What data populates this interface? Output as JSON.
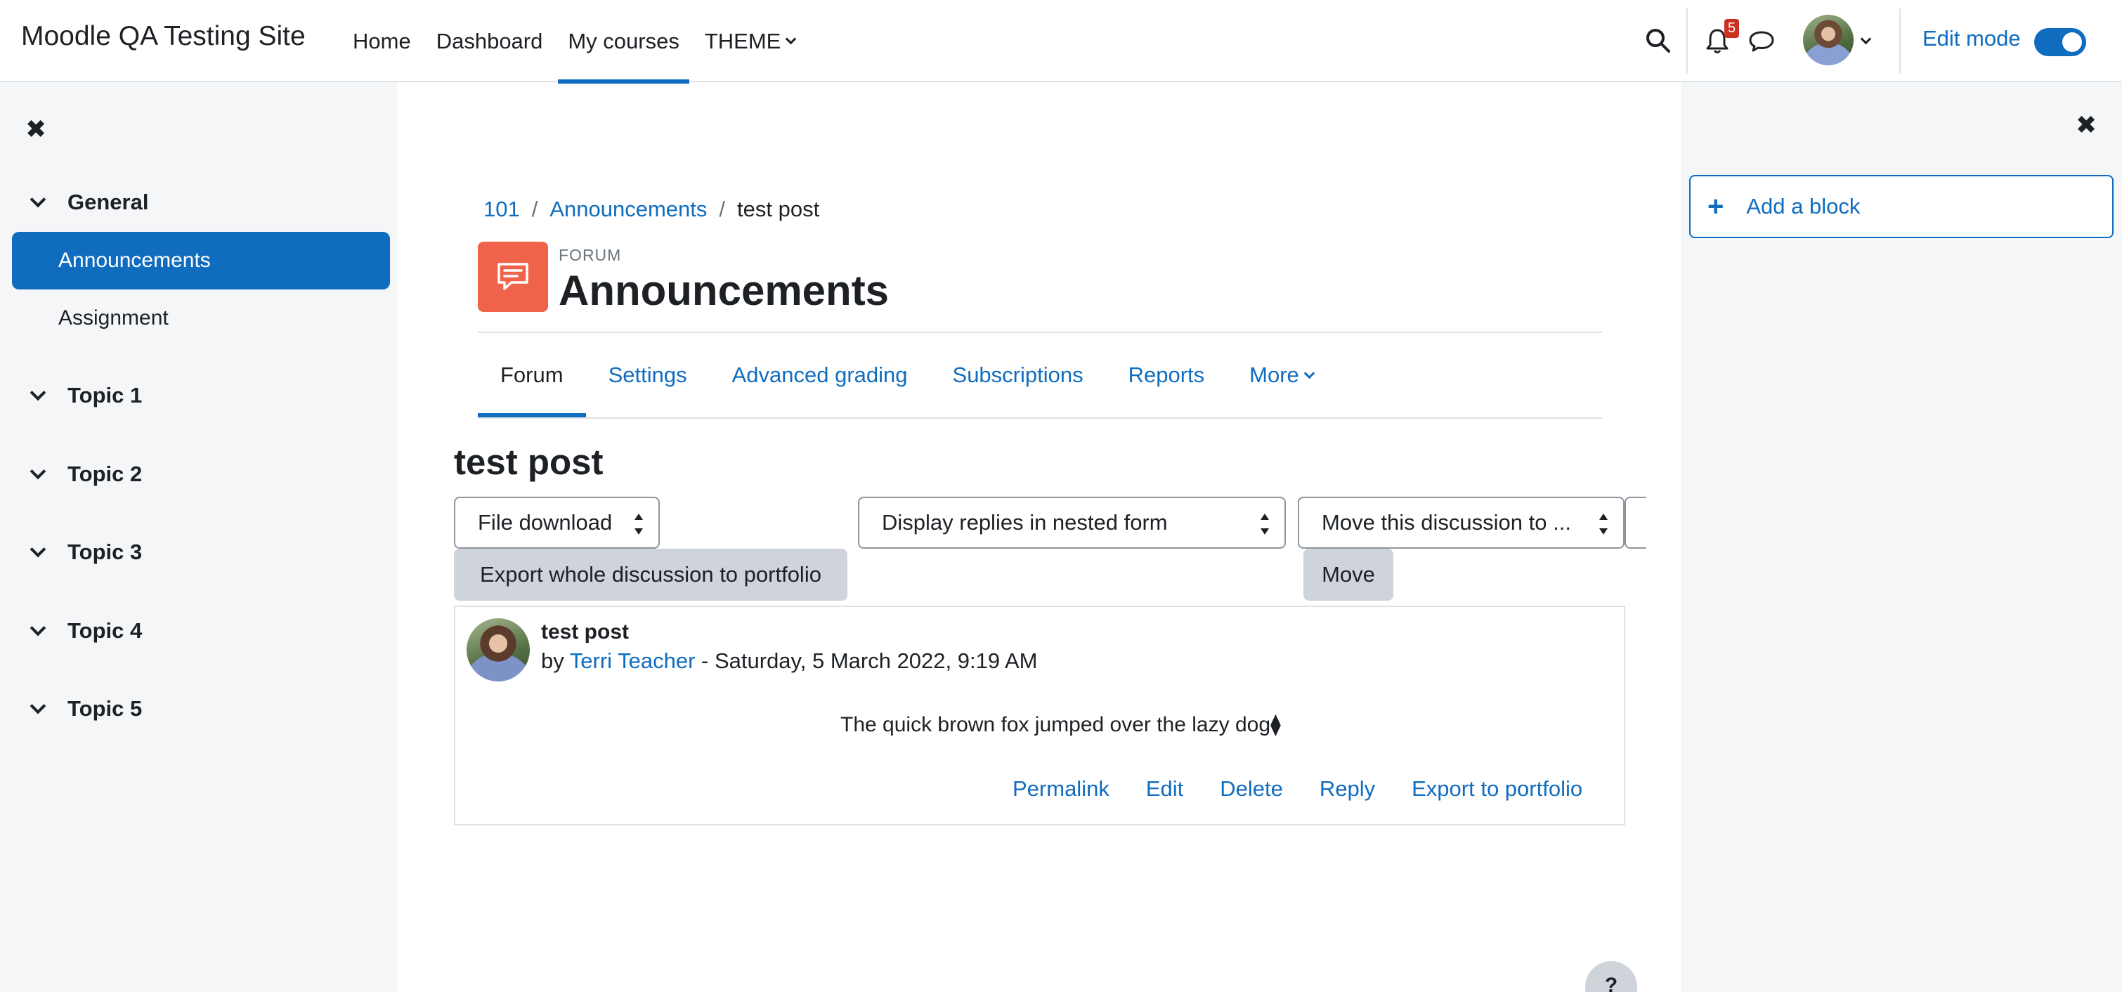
{
  "navbar": {
    "site_name": "Moodle QA Testing Site",
    "items": [
      {
        "label": "Home"
      },
      {
        "label": "Dashboard"
      },
      {
        "label": "My courses"
      },
      {
        "label": "THEME"
      }
    ],
    "active_item": "My courses",
    "notification_count": "5",
    "edit_mode_label": "Edit mode",
    "edit_mode_on": true,
    "icons": [
      "search-icon",
      "bell-icon",
      "message-icon",
      "avatar",
      "chevron-down-icon"
    ]
  },
  "course_index": {
    "close_icon": "close-icon",
    "sections": [
      {
        "label": "General",
        "items": [
          {
            "label": "Announcements",
            "active": true
          },
          {
            "label": "Assignment"
          }
        ]
      },
      {
        "label": "Topic 1"
      },
      {
        "label": "Topic 2"
      },
      {
        "label": "Topic 3"
      },
      {
        "label": "Topic 4"
      },
      {
        "label": "Topic 5"
      }
    ]
  },
  "block_drawer": {
    "close_icon": "close-icon",
    "add_block_label": "Add a block"
  },
  "breadcrumb": {
    "items": [
      "101",
      "Announcements"
    ],
    "current": "test post",
    "separator": "/"
  },
  "page_header": {
    "module_type": "FORUM",
    "title": "Announcements",
    "icon": "forum-icon",
    "icon_color": "#f0634b"
  },
  "secondary_nav": {
    "tabs": [
      {
        "label": "Forum",
        "active": true
      },
      {
        "label": "Settings"
      },
      {
        "label": "Advanced grading"
      },
      {
        "label": "Subscriptions"
      },
      {
        "label": "Reports"
      },
      {
        "label": "More"
      }
    ]
  },
  "discussion": {
    "title": "test post",
    "file_download_select": "File download",
    "export_button": "Export whole discussion to portfolio",
    "display_mode_select": "Display replies in nested form",
    "move_select": "Move this discussion to ...",
    "move_button": "Move"
  },
  "post": {
    "subject": "test post",
    "by_prefix": "by",
    "author": "Terri Teacher",
    "date_text": " - Saturday, 5 March 2022, 9:19 AM",
    "body": "The quick brown fox jumped over the lazy dog⧫",
    "actions": [
      "Permalink",
      "Edit",
      "Delete",
      "Reply",
      "Export to portfolio"
    ]
  },
  "help_button_label": "?",
  "colors": {
    "accent": "#0f6cbf",
    "drawer_bg": "#f5f6f8",
    "badge": "#ca3120",
    "button_grey": "#ced4da"
  }
}
